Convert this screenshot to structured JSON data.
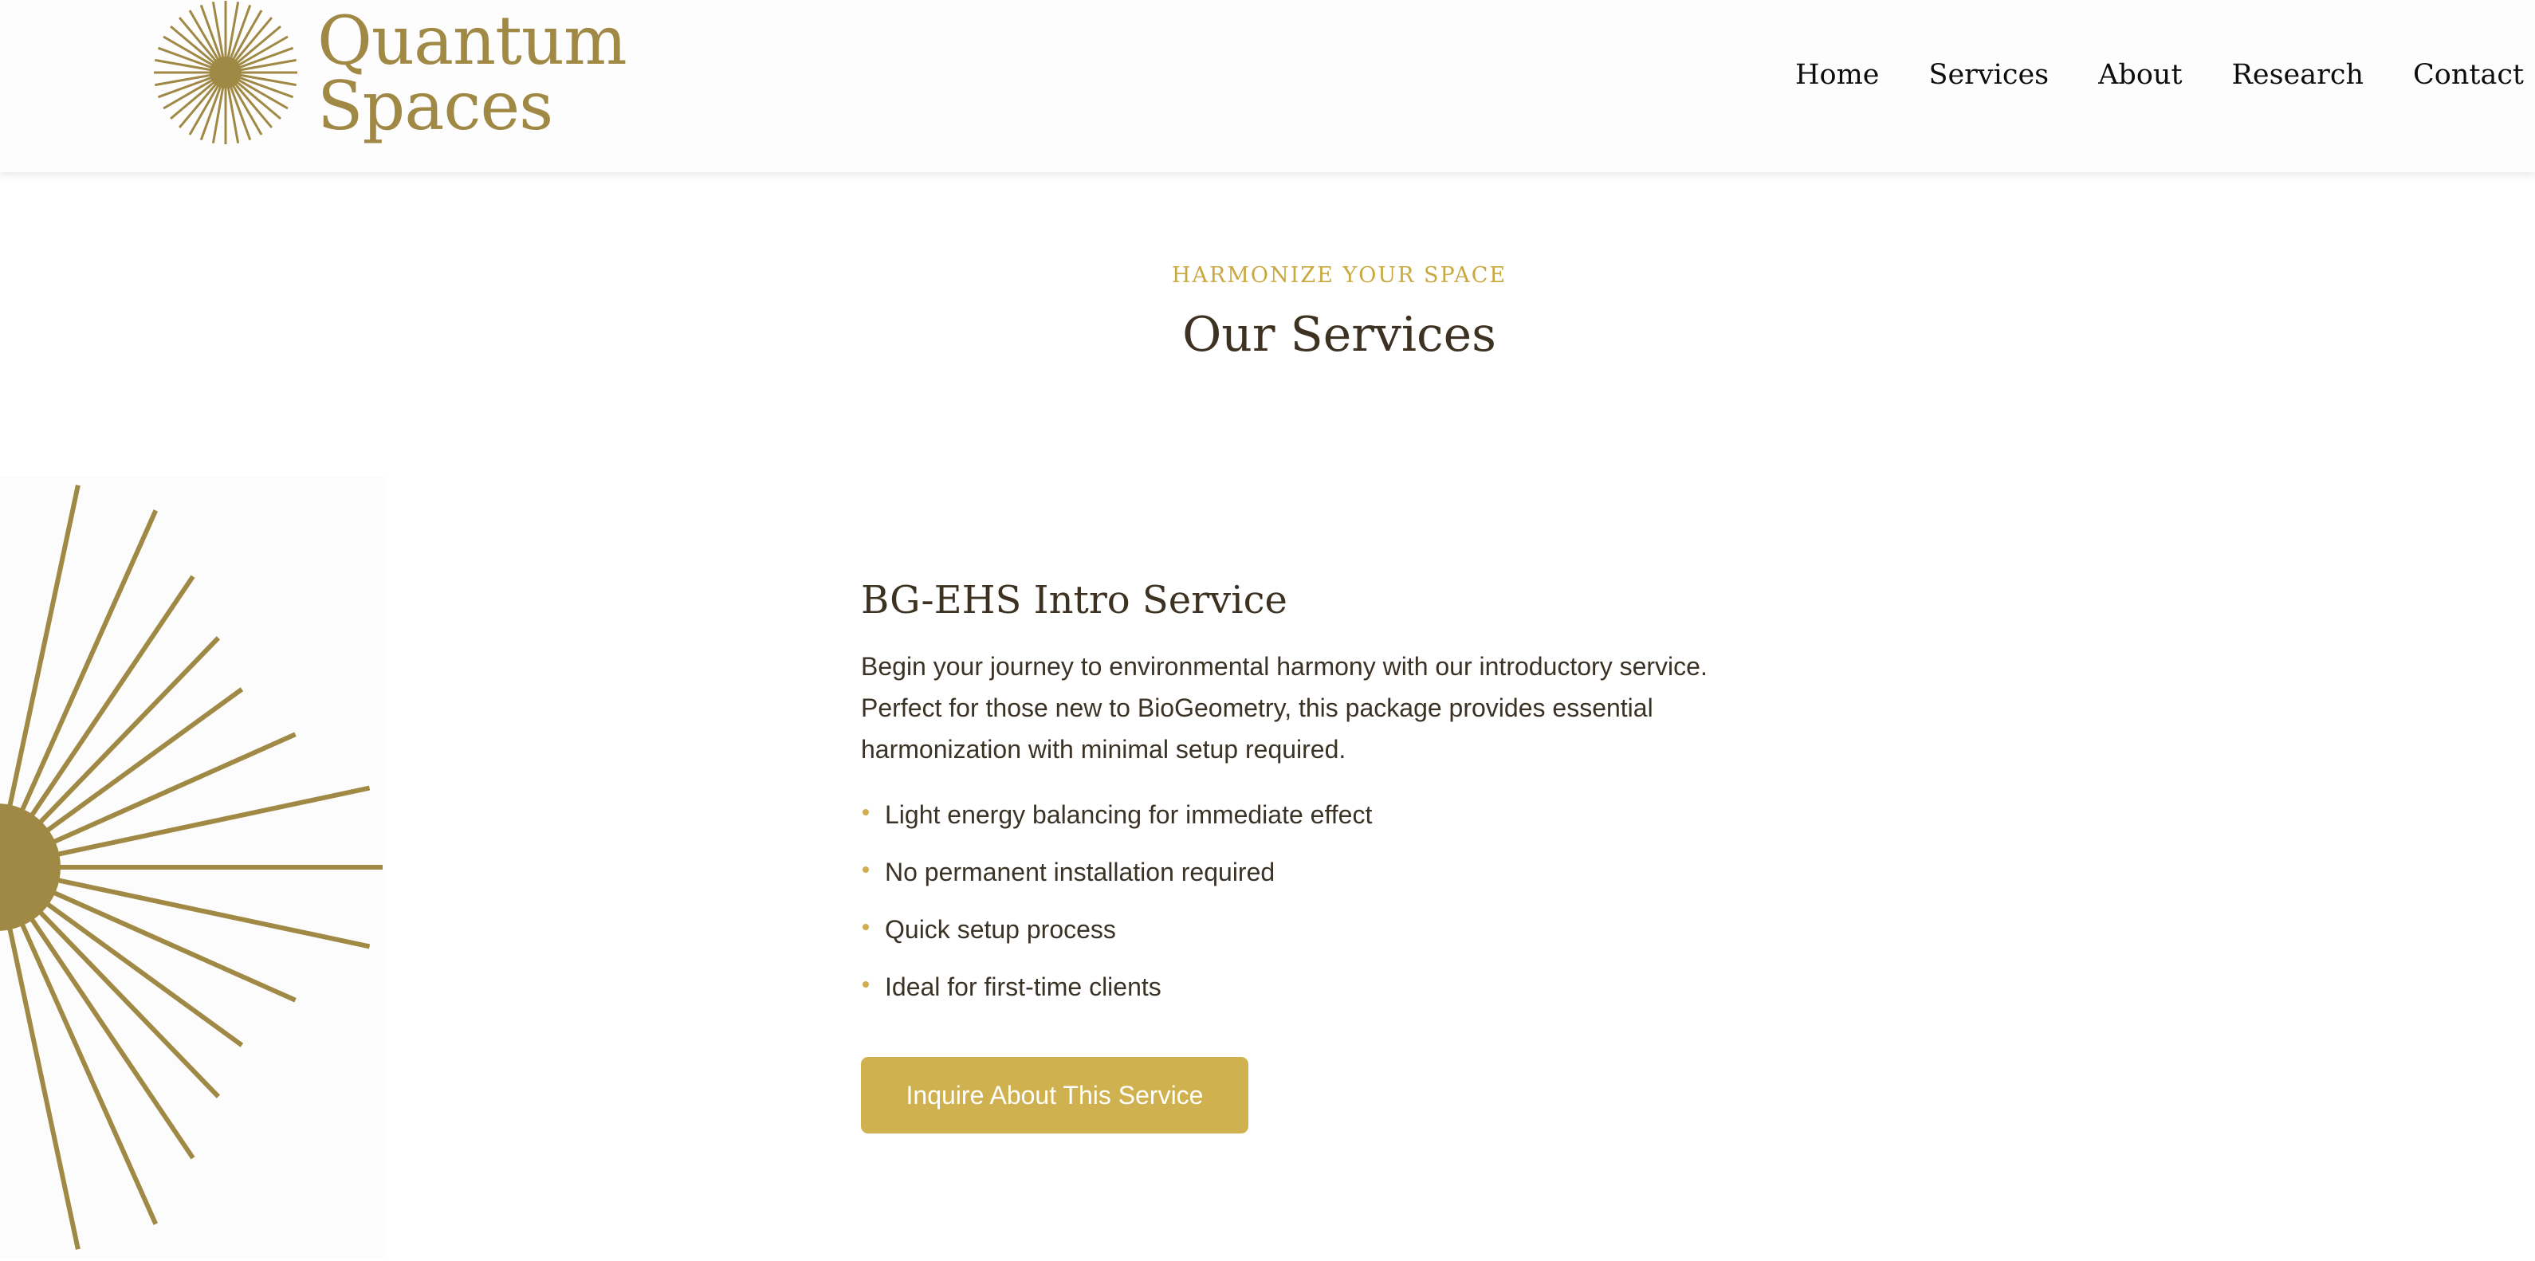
{
  "header": {
    "brand": {
      "line1": "Quantum",
      "line2": "Spaces",
      "logo_icon": "sunburst-logo-icon"
    },
    "nav": [
      {
        "label": "Home"
      },
      {
        "label": "Services"
      },
      {
        "label": "About"
      },
      {
        "label": "Research"
      },
      {
        "label": "Contact"
      }
    ]
  },
  "section": {
    "eyebrow": "HARMONIZE YOUR SPACE",
    "title": "Our Services"
  },
  "service": {
    "title": "BG-EHS Intro Service",
    "description": "Begin your journey to environmental harmony with our introductory service. Perfect for those new to BioGeometry, this package provides essential harmonization with minimal setup required.",
    "features": [
      "Light energy balancing for immediate effect",
      "No permanent installation required",
      "Quick setup process",
      "Ideal for first-time clients"
    ],
    "cta_label": "Inquire About This Service",
    "illustration_icon": "sunburst-illustration"
  },
  "colors": {
    "brand_gold": "#a08845",
    "accent_gold": "#c9a83f",
    "button_gold": "#d0b14f",
    "heading_brown": "#3d3121"
  }
}
